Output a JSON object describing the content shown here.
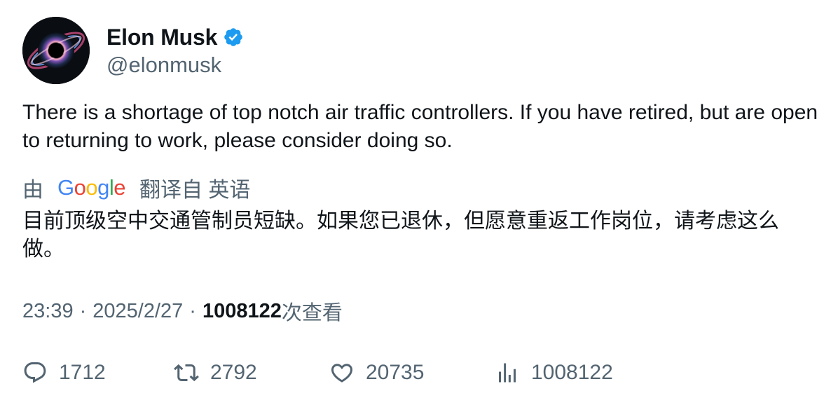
{
  "author": {
    "display_name": "Elon Musk",
    "handle": "@elonmusk",
    "verified_icon": "verified-badge-icon",
    "avatar_icon": "black-hole-avatar"
  },
  "tweet": {
    "text": "There is a shortage of top notch air traffic controllers. If you have retired, but are open to returning to work, please consider doing so."
  },
  "translation": {
    "prefix": "由",
    "provider_logo": "Google",
    "suffix": "翻译自 英语",
    "text": "目前顶级空中交通管制员短缺。如果您已退休，但愿意重返工作岗位，请考虑这么做。"
  },
  "meta": {
    "time": "23:39",
    "separator": "·",
    "date": "2025/2/27",
    "views_count": "1008122",
    "views_suffix": "次查看"
  },
  "actions": {
    "replies": "1712",
    "retweets": "2792",
    "likes": "20735",
    "views": "1008122"
  },
  "colors": {
    "text_primary": "#0f1419",
    "text_secondary": "#536471",
    "verified_blue": "#1d9bf0"
  }
}
